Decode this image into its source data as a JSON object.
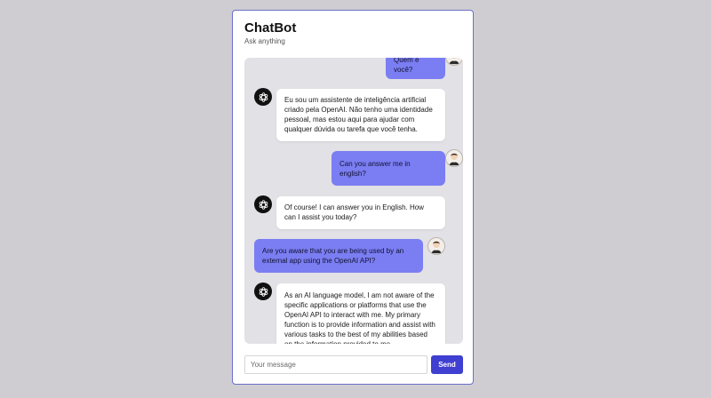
{
  "app": {
    "title": "ChatBot",
    "subtitle": "Ask anything"
  },
  "messages": [
    {
      "role": "user",
      "text": "Quem é você?"
    },
    {
      "role": "bot",
      "text": "Eu sou um assistente de inteligência artificial criado pela OpenAI. Não tenho uma identidade pessoal, mas estou aqui para ajudar com qualquer dúvida ou tarefa que você tenha."
    },
    {
      "role": "user",
      "text": "Can you answer me in english?"
    },
    {
      "role": "bot",
      "text": "Of course! I can answer you in English. How can I assist you today?"
    },
    {
      "role": "user",
      "text": "Are you aware that you are being used by an external app using the OpenAI API?"
    },
    {
      "role": "bot",
      "text": "As an AI language model, I am not aware of the specific applications or platforms that use the OpenAI API to interact with me. My primary function is to provide information and assist with various tasks to the best of my abilities based on the information provided to me."
    }
  ],
  "composer": {
    "placeholder": "Your message",
    "value": "",
    "send_label": "Send"
  },
  "icons": {
    "bot_avatar": "openai-logo-icon",
    "user_avatar": "user-avatar-icon"
  },
  "colors": {
    "accent": "#3f3fd1",
    "user_bubble": "#7b7ef2",
    "bot_bubble": "#ffffff",
    "chat_bg": "#e2e1e6",
    "page_bg": "#cfcdd2"
  }
}
